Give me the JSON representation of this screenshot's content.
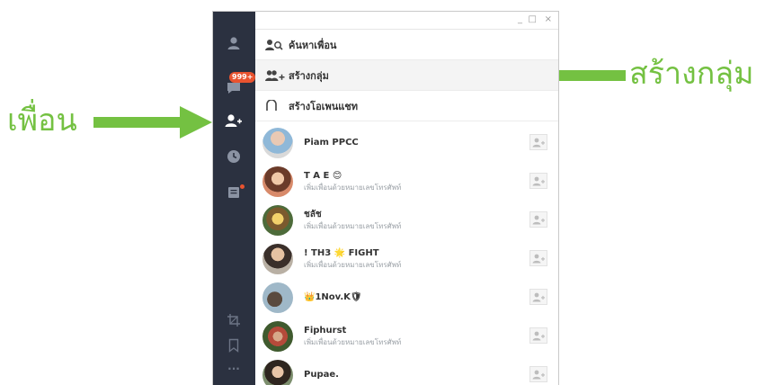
{
  "annotations": {
    "left_label": "เพื่อน",
    "right_label": "สร้างกลุ่ม",
    "accent_color": "#74c142"
  },
  "window": {
    "controls": {
      "minimize": "_",
      "maximize": "□",
      "close": "×"
    }
  },
  "rail": {
    "items": [
      {
        "icon": "profile-icon"
      },
      {
        "icon": "chat-icon",
        "badge": "999+"
      },
      {
        "icon": "add-friend-icon",
        "active": true
      },
      {
        "icon": "clock-icon"
      },
      {
        "icon": "notes-icon",
        "has_dot": true
      },
      {
        "icon": "crop-icon"
      },
      {
        "icon": "bookmark-icon"
      },
      {
        "icon": "more-icon",
        "label": "···"
      }
    ]
  },
  "menu": {
    "search_friends": "ค้นหาเพื่อน",
    "create_group": "สร้างกลุ่ม",
    "create_openchat": "สร้างโอเพนแชท"
  },
  "friends": [
    {
      "name": "Piam PPCC",
      "status": ""
    },
    {
      "name": "T A E 😊",
      "status": "เพิ่มเพื่อนด้วยหมายเลขโทรศัพท์"
    },
    {
      "name": "ชลัช",
      "status": "เพิ่มเพื่อนด้วยหมายเลขโทรศัพท์"
    },
    {
      "name": "!      TH3 🌟 FIGHT",
      "status": "เพิ่มเพื่อนด้วยหมายเลขโทรศัพท์"
    },
    {
      "name": "👑1Nov.K🛡",
      "status": ""
    },
    {
      "name": "Fiphurst",
      "status": "เพิ่มเพื่อนด้วยหมายเลขโทรศัพท์"
    },
    {
      "name": "Pupae.",
      "status": ""
    }
  ],
  "colors": {
    "rail_bg": "#2b3140",
    "badge": "#e9532f"
  }
}
